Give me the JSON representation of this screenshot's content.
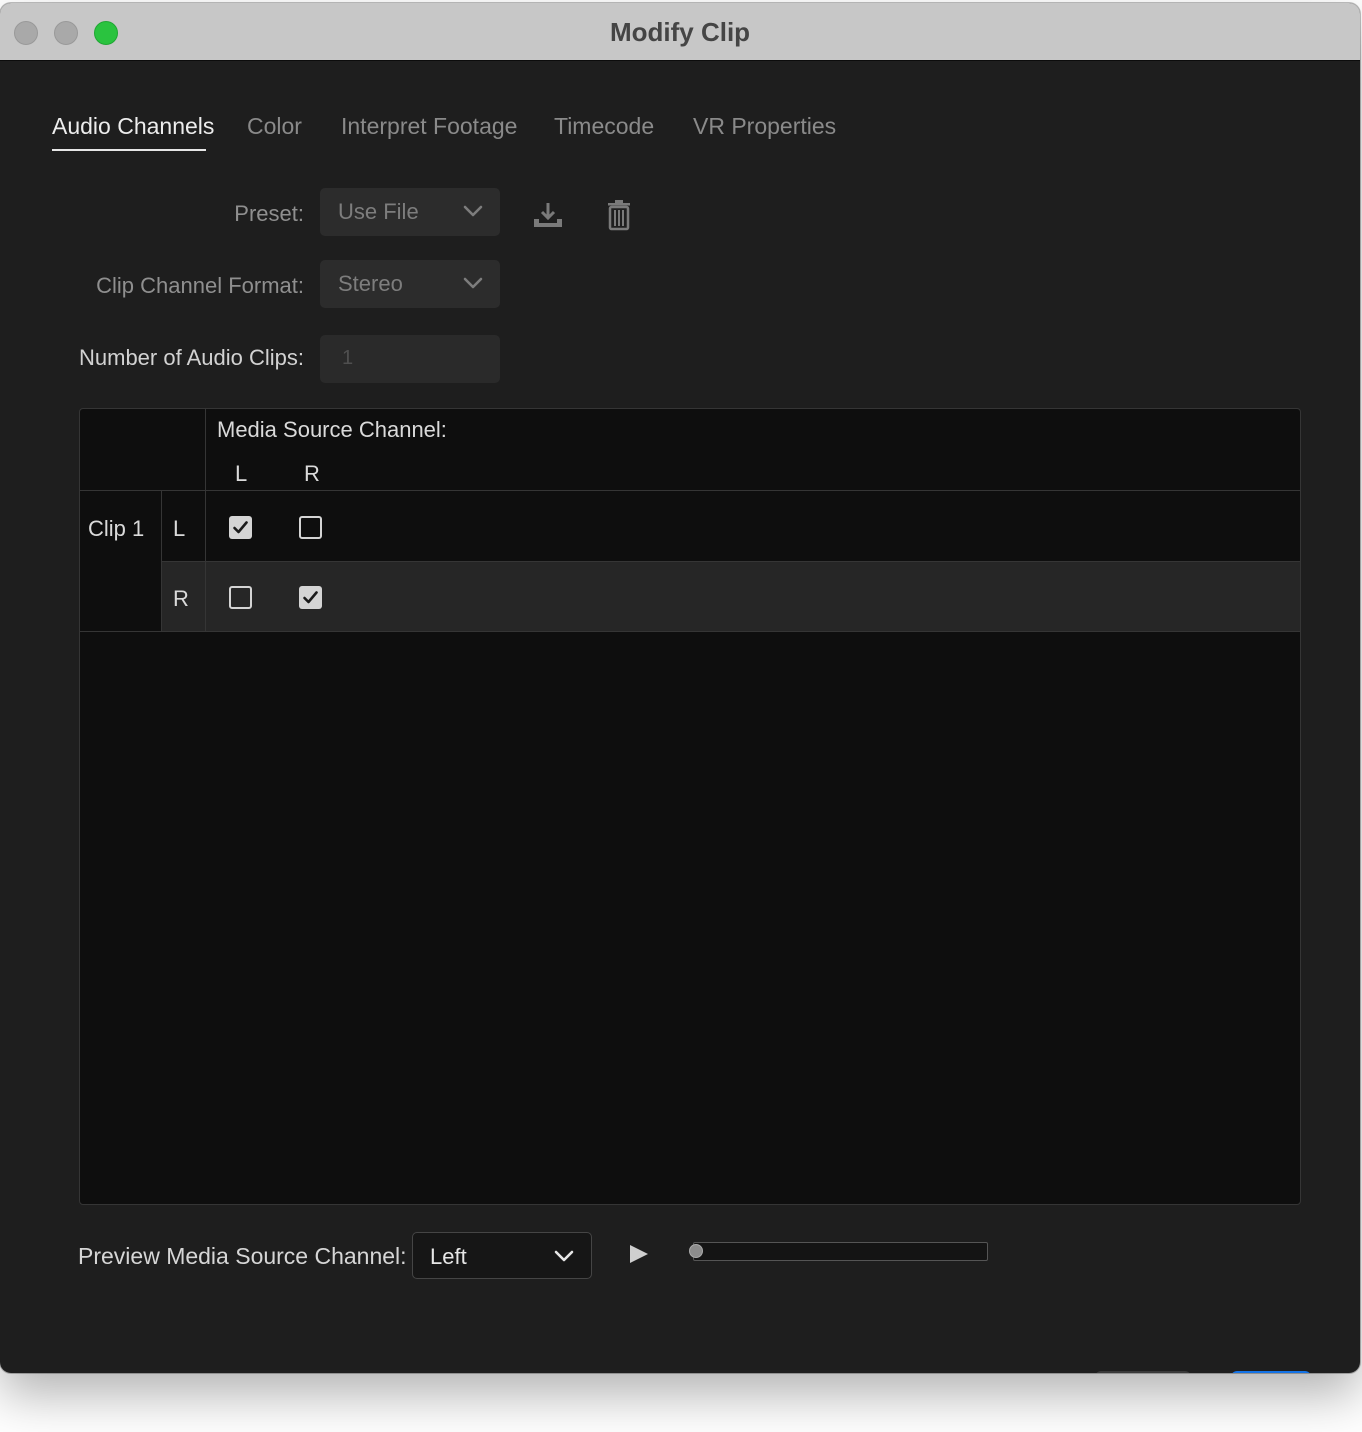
{
  "window": {
    "title": "Modify Clip"
  },
  "tabs": [
    {
      "label": "Audio Channels",
      "active": true
    },
    {
      "label": "Color",
      "active": false
    },
    {
      "label": "Interpret Footage",
      "active": false
    },
    {
      "label": "Timecode",
      "active": false
    },
    {
      "label": "VR Properties",
      "active": false
    }
  ],
  "form": {
    "preset_label": "Preset:",
    "preset_value": "Use File",
    "clip_channel_format_label": "Clip Channel Format:",
    "clip_channel_format_value": "Stereo",
    "num_audio_clips_label": "Number of Audio Clips:",
    "num_audio_clips_value": "1"
  },
  "channel_grid": {
    "header": "Media Source Channel:",
    "source_channels": [
      "L",
      "R"
    ],
    "clips": [
      {
        "label": "Clip 1",
        "rows": [
          {
            "channel": "L",
            "checked": [
              true,
              false
            ]
          },
          {
            "channel": "R",
            "checked": [
              false,
              true
            ]
          }
        ]
      }
    ]
  },
  "preview": {
    "label": "Preview Media Source Channel:",
    "value": "Left",
    "progress": 0
  },
  "colors": {
    "window_bg": "#1e1e1e",
    "titlebar": "#c7c7c7",
    "zoom_button": "#2ac33f",
    "accent_blue": "#1473e6"
  }
}
